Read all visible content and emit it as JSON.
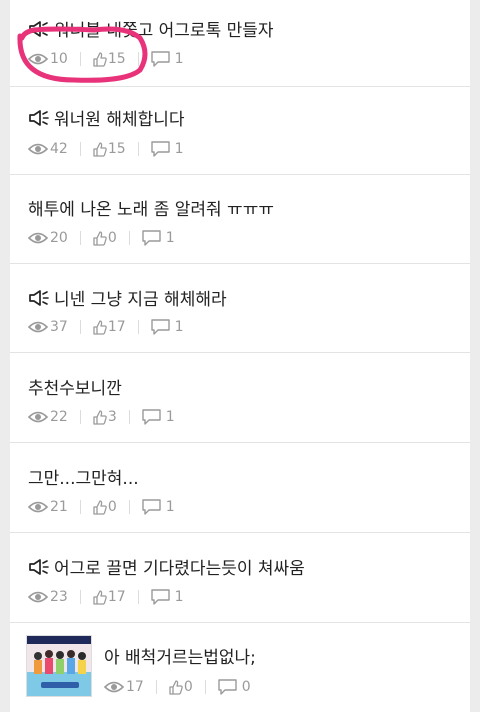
{
  "posts": [
    {
      "title": "워너블 내쫓고 어그로톡 만들자",
      "notice": true,
      "views": "10",
      "likes": "15",
      "comments": "1"
    },
    {
      "title": "워너원 해체합니다",
      "notice": true,
      "views": "42",
      "likes": "15",
      "comments": "1"
    },
    {
      "title": "해투에 나온 노래 좀 알려줘 ㅠㅠㅠ",
      "notice": false,
      "views": "20",
      "likes": "0",
      "comments": "1"
    },
    {
      "title": "니넨 그냥 지금 해체해라",
      "notice": true,
      "views": "37",
      "likes": "17",
      "comments": "1"
    },
    {
      "title": "추천수보니깐",
      "notice": false,
      "views": "22",
      "likes": "3",
      "comments": "1"
    },
    {
      "title": "그만...그만혀...",
      "notice": false,
      "views": "21",
      "likes": "0",
      "comments": "1"
    },
    {
      "title": "어그로 끌면 기다렸다는듯이 쳐싸움",
      "notice": true,
      "views": "23",
      "likes": "17",
      "comments": "1"
    },
    {
      "title": "아 배척거르는법없나;",
      "notice": false,
      "views": "17",
      "likes": "0",
      "comments": "0"
    }
  ],
  "colors": {
    "annotation": "#e8327a",
    "meta_text": "#9a9a9a",
    "title_text": "#222222",
    "background": "#ececec"
  },
  "icons": {
    "notice": "megaphone-icon",
    "views": "eye-icon",
    "likes": "thumbs-up-icon",
    "comments": "comment-icon"
  }
}
